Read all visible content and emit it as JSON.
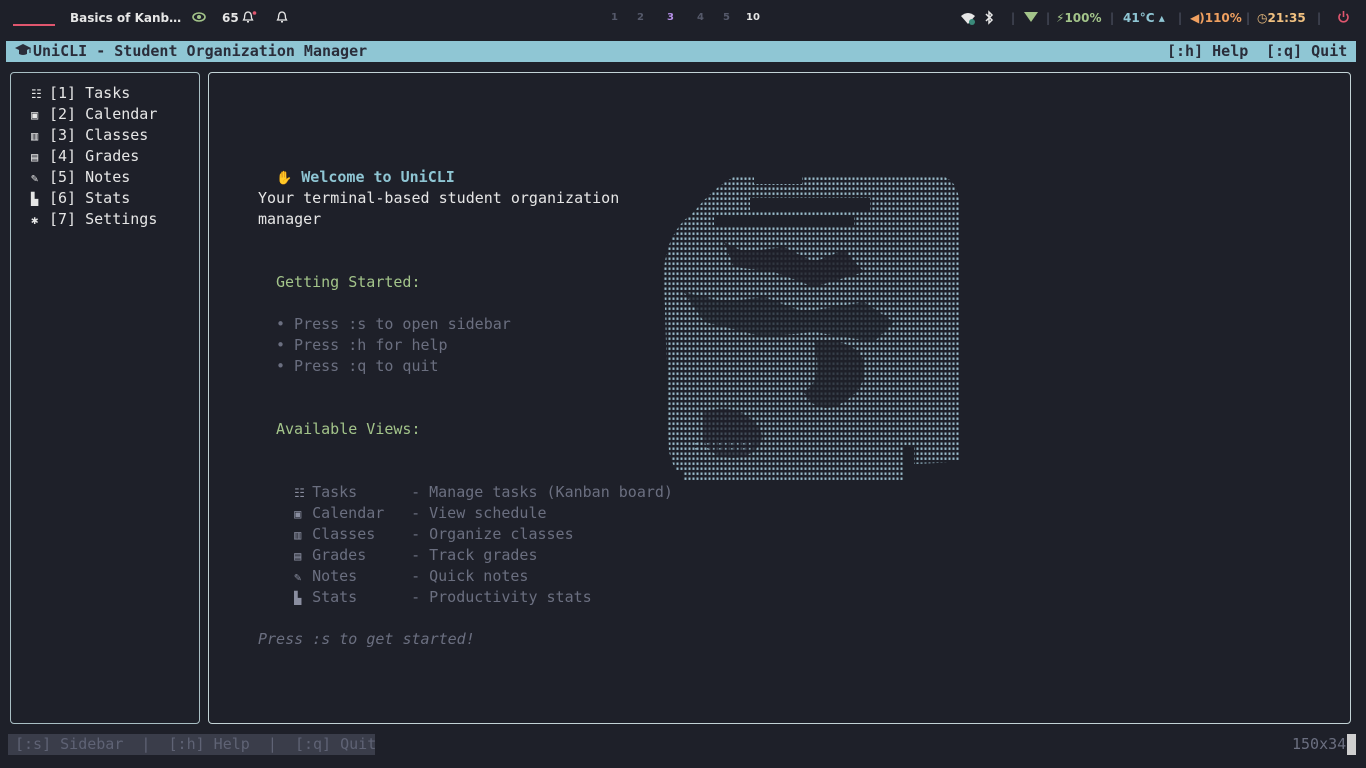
{
  "topbar": {
    "window_title": "Basics of Kanb…",
    "visibility_icon": "eye-icon",
    "notification_count": "65",
    "bell_icon": "bell-icon",
    "dnd_icon": "bell-off-icon",
    "workspaces": [
      "1",
      "2",
      "3",
      "4",
      "5",
      "10"
    ],
    "active_workspace": "3",
    "wifi_icon": "wifi-icon",
    "bluetooth_icon": "bluetooth-icon",
    "signal_icon": "signal-icon",
    "battery": "100%",
    "temperature": "41°C",
    "volume": "110%",
    "clock": "21:35",
    "power_icon": "power-icon",
    "colors": {
      "accent": "#b48ee6",
      "alert": "#e0566e",
      "ok": "#a3c48a",
      "warn": "#f0a060"
    }
  },
  "terminal": {
    "title": "UniCLI - Student Organization Manager",
    "help_hint": "[:h] Help",
    "quit_hint": "[:q] Quit",
    "title_color": "#8fc6d4"
  },
  "sidebar": {
    "items": [
      {
        "key": "[1]",
        "label": "Tasks",
        "icon": "checklist-icon"
      },
      {
        "key": "[2]",
        "label": "Calendar",
        "icon": "calendar-icon"
      },
      {
        "key": "[3]",
        "label": "Classes",
        "icon": "books-icon"
      },
      {
        "key": "[4]",
        "label": "Grades",
        "icon": "gradebook-icon"
      },
      {
        "key": "[5]",
        "label": "Notes",
        "icon": "notes-icon"
      },
      {
        "key": "[6]",
        "label": "Stats",
        "icon": "bar-chart-icon"
      },
      {
        "key": "[7]",
        "label": "Settings",
        "icon": "gear-icon"
      }
    ]
  },
  "main": {
    "welcome": "Welcome to UniCLI",
    "tagline_1": "Your terminal-based student organization",
    "tagline_2": "manager",
    "getting_started_heading": "Getting Started:",
    "getting_started": [
      "• Press :s to open sidebar",
      "• Press :h for help",
      "• Press :q to quit"
    ],
    "views_heading": "Available Views:",
    "views": [
      {
        "name": "Tasks",
        "desc": "- Manage tasks (Kanban board)"
      },
      {
        "name": "Calendar",
        "desc": "- View schedule"
      },
      {
        "name": "Classes",
        "desc": "- Organize classes"
      },
      {
        "name": "Grades",
        "desc": "- Track grades"
      },
      {
        "name": "Notes",
        "desc": "- Quick notes"
      },
      {
        "name": "Stats",
        "desc": "- Productivity stats"
      }
    ],
    "footer": "Press :s to get started!"
  },
  "bottombar": {
    "hints": "[:s] Sidebar  |  [:h] Help  |  [:q] Quit",
    "terminal_size": "150x34"
  }
}
